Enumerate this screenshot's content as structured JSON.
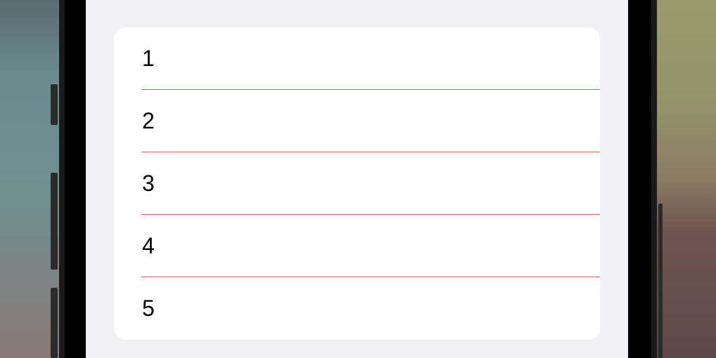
{
  "list": {
    "items": [
      {
        "label": "1"
      },
      {
        "label": "2"
      },
      {
        "label": "3"
      },
      {
        "label": "4"
      },
      {
        "label": "5"
      }
    ]
  },
  "colors": {
    "screen_background": "#f1f0f5",
    "card_background": "#ffffff",
    "separator": "#e05a5a",
    "text": "#000000"
  }
}
